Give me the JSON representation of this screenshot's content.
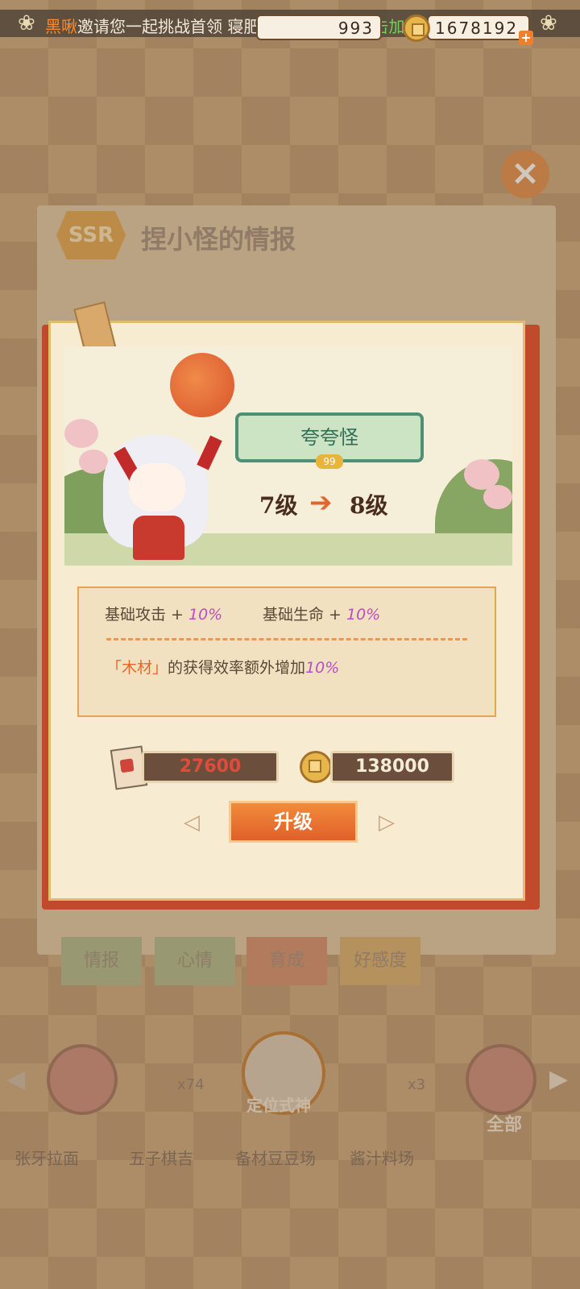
{
  "topbar": {
    "player_name": "黑啾",
    "message": "邀请您一起挑战首领 寝肥合战：一星，",
    "click_join": "点击加入",
    "resource_amount": "993",
    "coins": "1678192"
  },
  "background_panel": {
    "rarity": "SSR",
    "title": "捏小怪的情报",
    "tabs": [
      "情报",
      "心情",
      "育成",
      "好感度"
    ],
    "locate_label": "定位式神",
    "count_left": "x74",
    "count_right": "x3",
    "all_label": "全部",
    "bottom_items": [
      "张牙拉面",
      "五子棋吉",
      "备材豆豆场",
      "酱汁料场"
    ]
  },
  "popup": {
    "name": "夸夸怪",
    "level_from": "7级",
    "level_to": "8级",
    "stats": [
      {
        "label": "基础攻击 + ",
        "value": "10%"
      },
      {
        "label": "基础生命 + ",
        "value": "10%"
      }
    ],
    "bonus": {
      "quote_open": "「",
      "resource": "木材",
      "quote_close": "」",
      "text": "的获得效率额外增加",
      "value": "10%"
    },
    "cost_cards": "27600",
    "cost_coins": "138000",
    "upgrade_label": "升级"
  },
  "colors": {
    "accent_orange": "#e0602a",
    "stat_value_purple": "#b84fc1",
    "popup_bg": "#f7ecd2",
    "plate_green": "#4f8f76"
  }
}
